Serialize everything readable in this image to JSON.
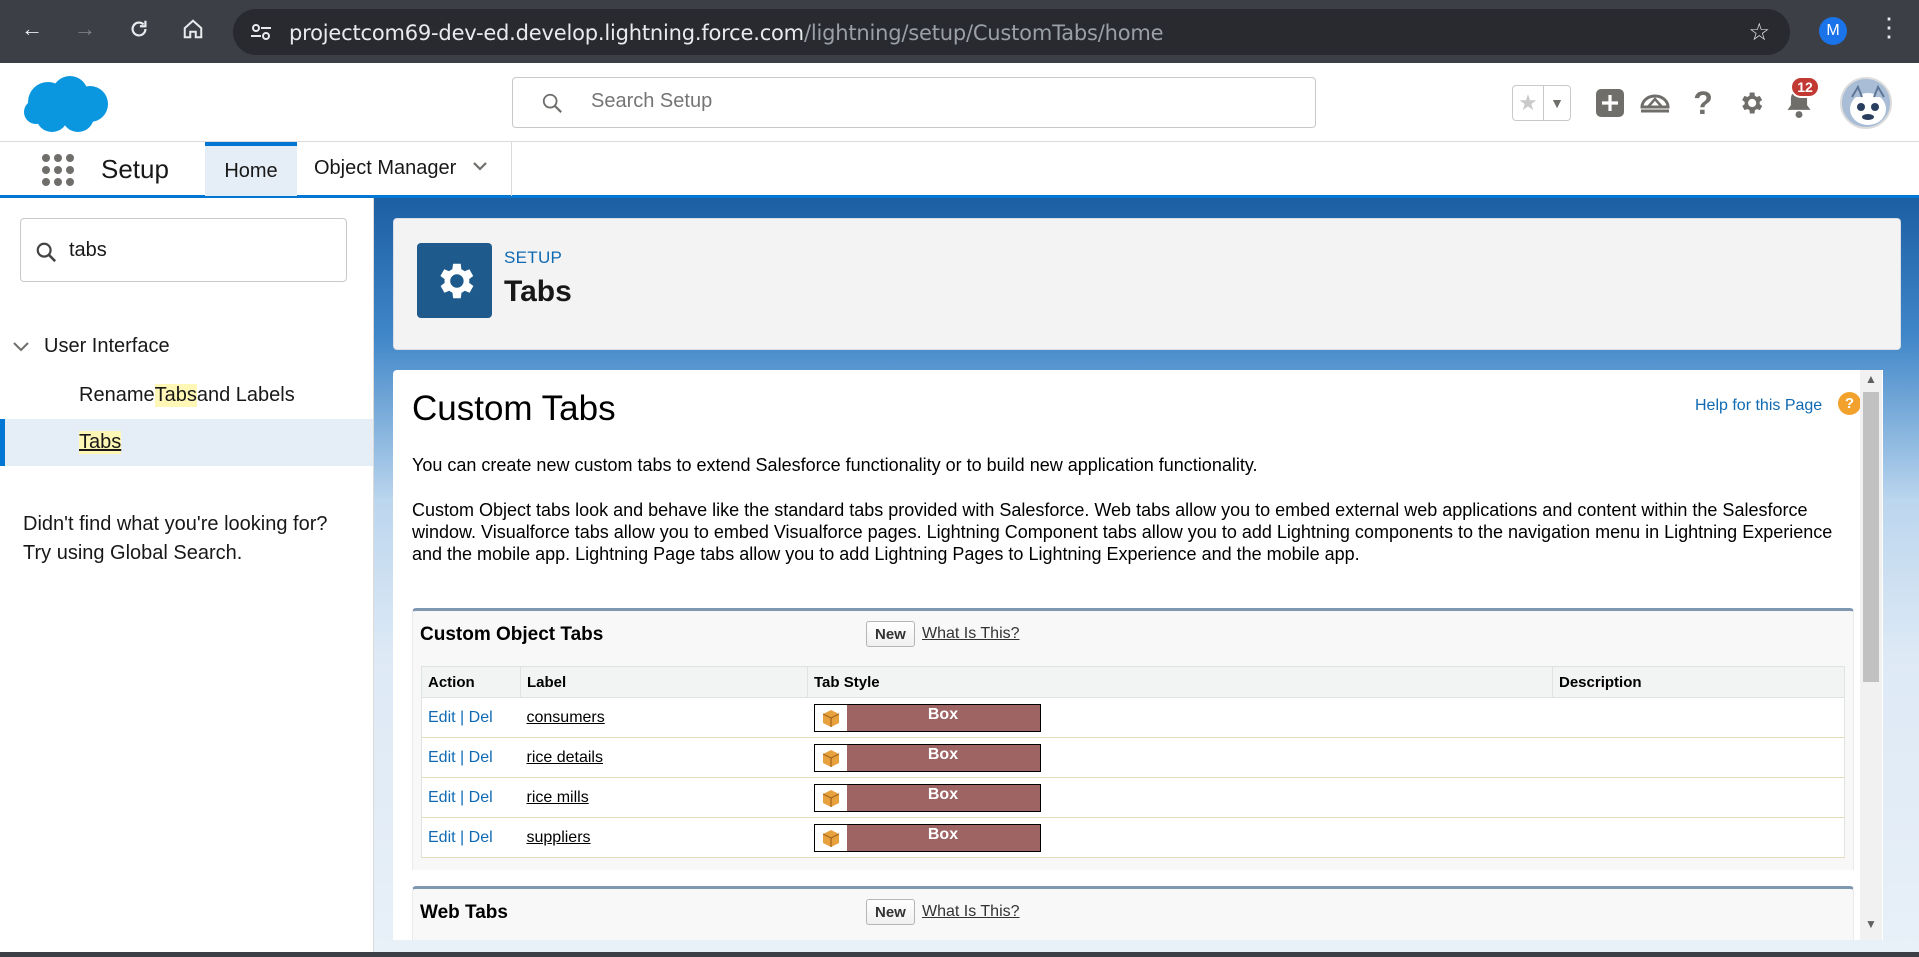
{
  "browser": {
    "url_host": "projectcom69-dev-ed.develop.lightning.force.com",
    "url_path": "/lightning/setup/CustomTabs/home",
    "profile_initial": "M"
  },
  "header": {
    "search_placeholder": "Search Setup",
    "notification_count": "12"
  },
  "nav": {
    "app_name": "Setup",
    "tabs": [
      {
        "label": "Home"
      },
      {
        "label": "Object Manager"
      }
    ]
  },
  "sidebar": {
    "quick_find_value": "tabs",
    "group_label": "User Interface",
    "items": [
      {
        "pre": "Rename ",
        "hl": "Tabs",
        "post": " and Labels"
      },
      {
        "label": "Tabs"
      }
    ],
    "not_found_line1": "Didn't find what you're looking for?",
    "not_found_line2": "Try using Global Search."
  },
  "page_header": {
    "breadcrumb": "SETUP",
    "title": "Tabs"
  },
  "content": {
    "heading": "Custom Tabs",
    "help_link": "Help for this Page",
    "intro": "You can create new custom tabs to extend Salesforce functionality or to build new application functionality.",
    "description": "Custom Object tabs look and behave like the standard tabs provided with Salesforce. Web tabs allow you to embed external web applications and content within the Salesforce window. Visualforce tabs allow you to embed Visualforce pages. Lightning Component tabs allow you to add Lightning components to the navigation menu in Lightning Experience and the mobile app. Lightning Page tabs allow you to add Lightning Pages to Lightning Experience and the mobile app.",
    "custom_object_tabs": {
      "title": "Custom Object Tabs",
      "new_label": "New",
      "what_label": "What Is This?",
      "columns": [
        "Action",
        "Label",
        "Tab Style",
        "Description"
      ],
      "edit_label": "Edit",
      "del_label": "Del",
      "sep": "|",
      "rows": [
        {
          "label": "consumers",
          "style": "Box",
          "description": ""
        },
        {
          "label": "rice details",
          "style": "Box",
          "description": ""
        },
        {
          "label": "rice mills",
          "style": "Box",
          "description": ""
        },
        {
          "label": "suppliers",
          "style": "Box",
          "description": ""
        }
      ]
    },
    "web_tabs": {
      "title": "Web Tabs",
      "new_label": "New",
      "what_label": "What Is This?"
    }
  },
  "colors": {
    "brand": "#0176d3",
    "tab_style_box": "#9e6363"
  }
}
